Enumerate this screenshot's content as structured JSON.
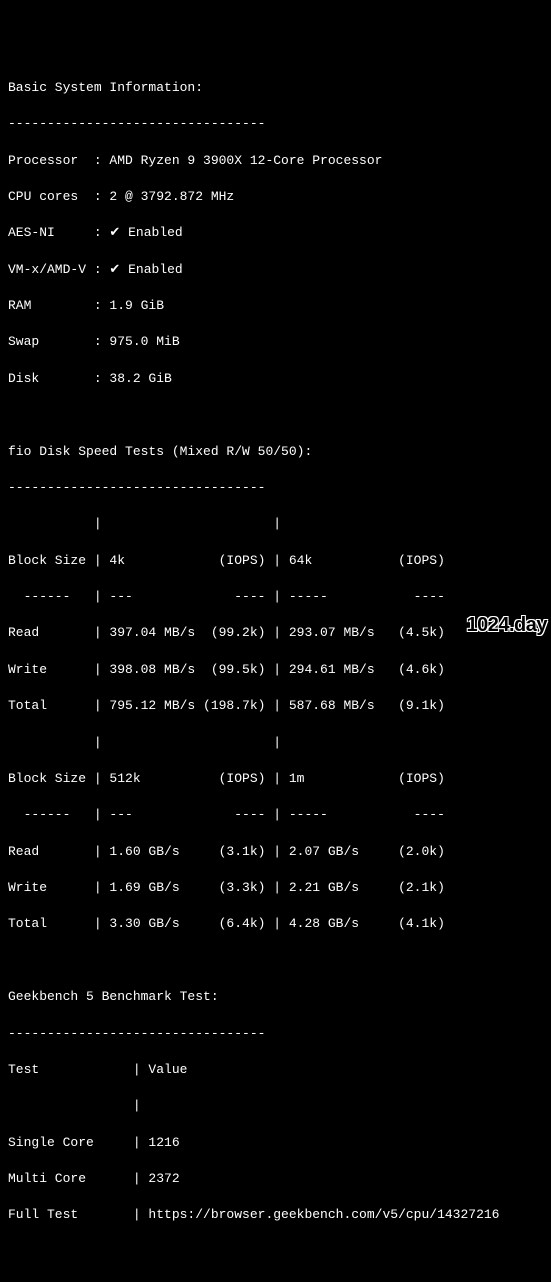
{
  "sys": {
    "title": "Basic System Information:",
    "rule": "---------------------------------",
    "rows": [
      {
        "label": "Processor",
        "value": "AMD Ryzen 9 3900X 12-Core Processor"
      },
      {
        "label": "CPU cores",
        "value": "2 @ 3792.872 MHz"
      },
      {
        "label": "AES-NI",
        "value": "✔ Enabled"
      },
      {
        "label": "VM-x/AMD-V",
        "value": "✔ Enabled"
      },
      {
        "label": "RAM",
        "value": "1.9 GiB"
      },
      {
        "label": "Swap",
        "value": "975.0 MiB"
      },
      {
        "label": "Disk",
        "value": "38.2 GiB"
      }
    ]
  },
  "fio": {
    "title": "fio Disk Speed Tests (Mixed R/W 50/50):",
    "rule": "---------------------------------",
    "header1": {
      "bs_label": "Block Size",
      "colA": "4k",
      "iopsA": "(IOPS)",
      "colB": "64k",
      "iopsB": "(IOPS)"
    },
    "dashrow": {
      "bs": "------",
      "dA": "---",
      "iA": "----",
      "dB": "-----",
      "iB": "----"
    },
    "set1": [
      {
        "label": "Read",
        "a_val": "397.04 MB/s",
        "a_iops": "(99.2k)",
        "b_val": "293.07 MB/s",
        "b_iops": "(4.5k)"
      },
      {
        "label": "Write",
        "a_val": "398.08 MB/s",
        "a_iops": "(99.5k)",
        "b_val": "294.61 MB/s",
        "b_iops": "(4.6k)"
      },
      {
        "label": "Total",
        "a_val": "795.12 MB/s",
        "a_iops": "(198.7k)",
        "b_val": "587.68 MB/s",
        "b_iops": "(9.1k)"
      }
    ],
    "header2": {
      "bs_label": "Block Size",
      "colA": "512k",
      "iopsA": "(IOPS)",
      "colB": "1m",
      "iopsB": "(IOPS)"
    },
    "set2": [
      {
        "label": "Read",
        "a_val": "1.60 GB/s",
        "a_iops": "(3.1k)",
        "b_val": "2.07 GB/s",
        "b_iops": "(2.0k)"
      },
      {
        "label": "Write",
        "a_val": "1.69 GB/s",
        "a_iops": "(3.3k)",
        "b_val": "2.21 GB/s",
        "b_iops": "(2.1k)"
      },
      {
        "label": "Total",
        "a_val": "3.30 GB/s",
        "a_iops": "(6.4k)",
        "b_val": "4.28 GB/s",
        "b_iops": "(4.1k)"
      }
    ]
  },
  "gb": {
    "title": "Geekbench 5 Benchmark Test:",
    "rule": "---------------------------------",
    "header": {
      "test": "Test",
      "value": "Value"
    },
    "rows": [
      {
        "label": "Single Core",
        "value": "1216"
      },
      {
        "label": "Multi Core",
        "value": "2372"
      },
      {
        "label": "Full Test",
        "value": "https://browser.geekbench.com/v5/cpu/14327216"
      }
    ]
  },
  "watermark": "1024.day"
}
